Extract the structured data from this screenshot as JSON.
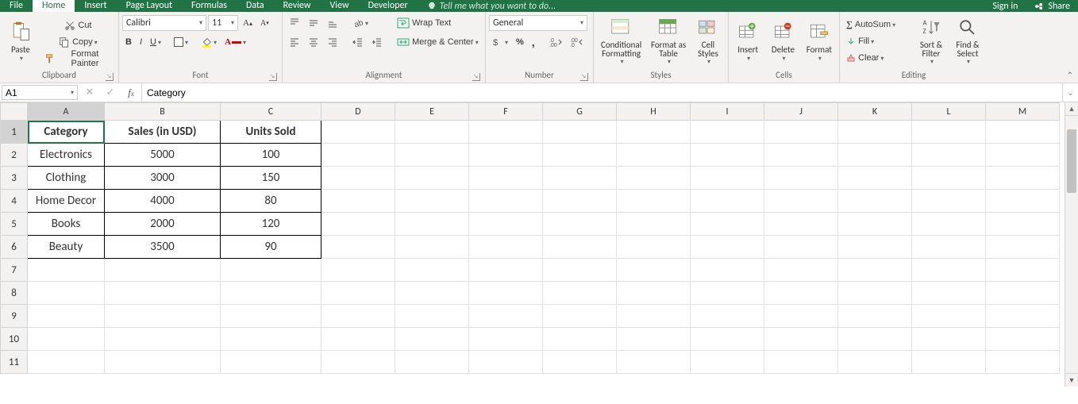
{
  "tabs": {
    "file": "File",
    "home": "Home",
    "insert": "Insert",
    "page_layout": "Page Layout",
    "formulas": "Formulas",
    "data": "Data",
    "review": "Review",
    "view": "View",
    "developer": "Developer",
    "tell_me": "Tell me what you want to do...",
    "sign_in": "Sign in",
    "share": "Share"
  },
  "ribbon": {
    "clipboard": {
      "paste": "Paste",
      "cut": "Cut",
      "copy": "Copy",
      "format_painter": "Format Painter",
      "label": "Clipboard"
    },
    "font": {
      "name": "Calibri",
      "size": "11",
      "label": "Font"
    },
    "alignment": {
      "wrap_text": "Wrap Text",
      "merge_center": "Merge & Center",
      "label": "Alignment"
    },
    "number": {
      "format": "General",
      "label": "Number"
    },
    "styles": {
      "cond": "Conditional Formatting",
      "table": "Format as Table",
      "cell": "Cell Styles",
      "label": "Styles"
    },
    "cells": {
      "insert": "Insert",
      "delete": "Delete",
      "format": "Format",
      "label": "Cells"
    },
    "editing": {
      "autosum": "AutoSum",
      "fill": "Fill",
      "clear": "Clear",
      "sort": "Sort & Filter",
      "find": "Find & Select",
      "label": "Editing"
    }
  },
  "namebox": "A1",
  "formula": "Category",
  "columns": [
    "A",
    "B",
    "C",
    "D",
    "E",
    "F",
    "G",
    "H",
    "I",
    "J",
    "K",
    "L",
    "M"
  ],
  "rows_visible": 11,
  "col_widths": {
    "A": 97,
    "B": 146,
    "C": 127,
    "other": 93
  },
  "active_cell": "A1",
  "data_range": {
    "r1": 1,
    "c1": 1,
    "r2": 6,
    "c2": 3
  },
  "sheet": {
    "1": {
      "A": "Category",
      "B": "Sales (in USD)",
      "C": "Units Sold"
    },
    "2": {
      "A": "Electronics",
      "B": "5000",
      "C": "100"
    },
    "3": {
      "A": "Clothing",
      "B": "3000",
      "C": "150"
    },
    "4": {
      "A": "Home Decor",
      "B": "4000",
      "C": "80"
    },
    "5": {
      "A": "Books",
      "B": "2000",
      "C": "120"
    },
    "6": {
      "A": "Beauty",
      "B": "3500",
      "C": "90"
    }
  },
  "chart_data": {
    "type": "table",
    "categories": [
      "Electronics",
      "Clothing",
      "Home Decor",
      "Books",
      "Beauty"
    ],
    "series": [
      {
        "name": "Sales (in USD)",
        "values": [
          5000,
          3000,
          4000,
          2000,
          3500
        ]
      },
      {
        "name": "Units Sold",
        "values": [
          100,
          150,
          80,
          120,
          90
        ]
      }
    ]
  }
}
